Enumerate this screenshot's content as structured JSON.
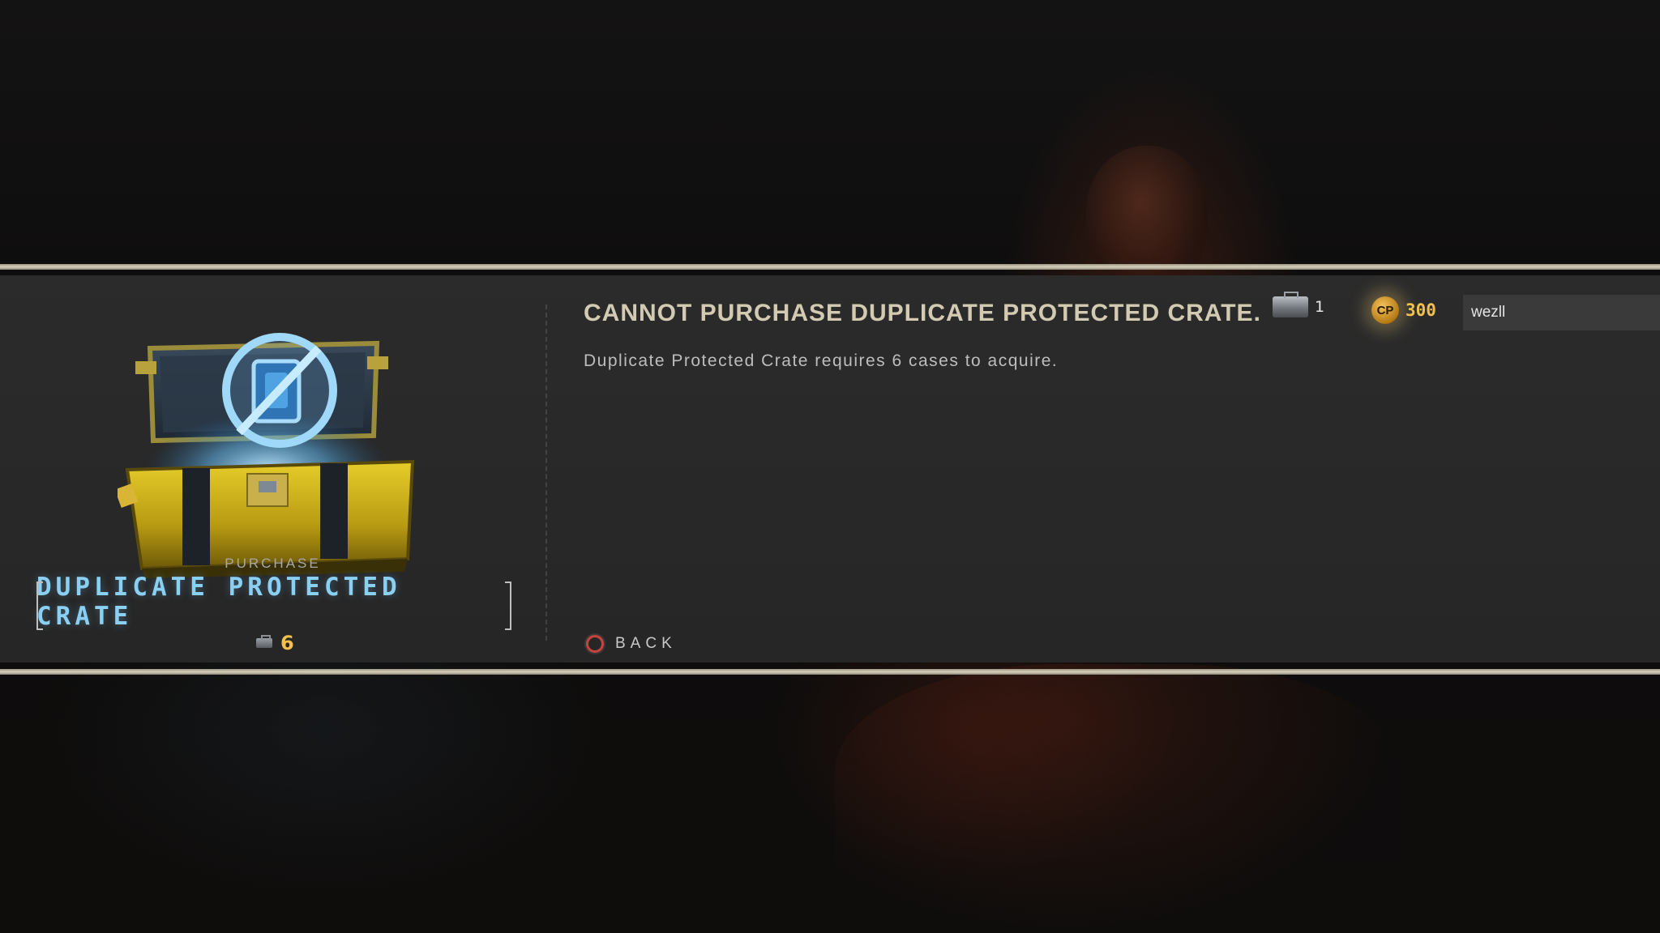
{
  "crate": {
    "action_label": "PURCHASE",
    "name": "DUPLICATE PROTECTED CRATE",
    "cost": "6"
  },
  "message": {
    "title": "CANNOT PURCHASE DUPLICATE PROTECTED CRATE.",
    "body": "Duplicate Protected Crate requires 6 cases to acquire."
  },
  "controls": {
    "back_label": "BACK"
  },
  "currencies": {
    "cases": "1",
    "cp_symbol": "CP",
    "cp": "300"
  },
  "player": {
    "name": "wezll"
  },
  "colors": {
    "accent_blue": "#8ad0f2",
    "gold": "#f2c14b",
    "back_button_red": "#c7433b"
  },
  "icons": {
    "crate_image": "duplicate-protected-crate-icon",
    "case": "case-icon",
    "cp": "cp-coin-icon",
    "back": "circle-button-icon"
  }
}
